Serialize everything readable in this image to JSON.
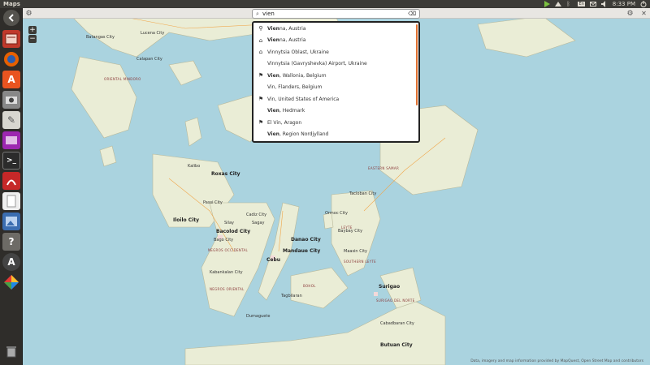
{
  "window": {
    "title": "Maps"
  },
  "tray": {
    "clock": "8:33 PM",
    "keyboard": "En"
  },
  "search": {
    "value": "vien"
  },
  "zoom": {
    "in_label": "+",
    "out_label": "−"
  },
  "suggestions": [
    {
      "bold": "Vien",
      "rest": "na, Austria",
      "icon": "city-icon"
    },
    {
      "bold": "Vien",
      "rest": "na, Austria",
      "icon": "building-icon"
    },
    {
      "bold": "",
      "rest": "Vinnytsia Oblast, Ukraine",
      "icon": "building-icon"
    },
    {
      "bold": "",
      "rest": "Vinnytsia (Gavryshevka) Airport, Ukraine",
      "icon": "none"
    },
    {
      "bold": "Vien",
      "rest": ", Wallonia, Belgium",
      "icon": "flag-icon"
    },
    {
      "bold": "",
      "rest": "Vin, Flanders, Belgium",
      "icon": "none"
    },
    {
      "bold": "",
      "rest": "Vin, United States of America",
      "icon": "flag-icon"
    },
    {
      "bold": "Vien",
      "rest": ", Hedmark",
      "icon": "none"
    },
    {
      "bold": "",
      "rest": "El Vin, Aragon",
      "icon": "flag-icon"
    },
    {
      "bold": "Vien",
      "rest": ", Region Nordjylland",
      "icon": "none"
    }
  ],
  "map_labels": {
    "batangas": "Batangas City",
    "lucena": "Lucena City",
    "oriental_mindoro": "ORIENTAL MINDORO",
    "calapan": "Calapan City",
    "kalibo": "Kalibo",
    "roxas": "Roxas City",
    "iloilo": "Iloilo City",
    "passi": "Passi City",
    "bacolod": "Bacolod City",
    "silay": "Silay",
    "bago": "Bago City",
    "cadiz": "Cadiz City",
    "sagay": "Sagay",
    "danao": "Danao City",
    "mandaue": "Mandaue City",
    "cebu": "Cebu",
    "negros_occidental": "NEGROS OCCIDENTAL",
    "kabankalan": "Kabankalan City",
    "negros_oriental": "NEGROS ORIENTAL",
    "dumaguete": "Dumaguete",
    "tagbilaran": "Tagbilaran",
    "bohol": "BOHOL",
    "ormoc": "Ormoc City",
    "tacloban": "Tacloban City",
    "baybay": "Baybay City",
    "maasin": "Maasin City",
    "surigao": "Surigao",
    "southern_leyte": "SOUTHERN LEYTE",
    "eastern_samar": "EASTERN SAMAR",
    "cabadbaran": "Cabadbaran City",
    "butuan": "Butuan City",
    "surigao_norte": "SURIGAO DEL NORTE",
    "leyte": "LEYTE"
  },
  "attribution": "Data, imagery and map information provided by MapQuest, Open Street Map and contributors"
}
